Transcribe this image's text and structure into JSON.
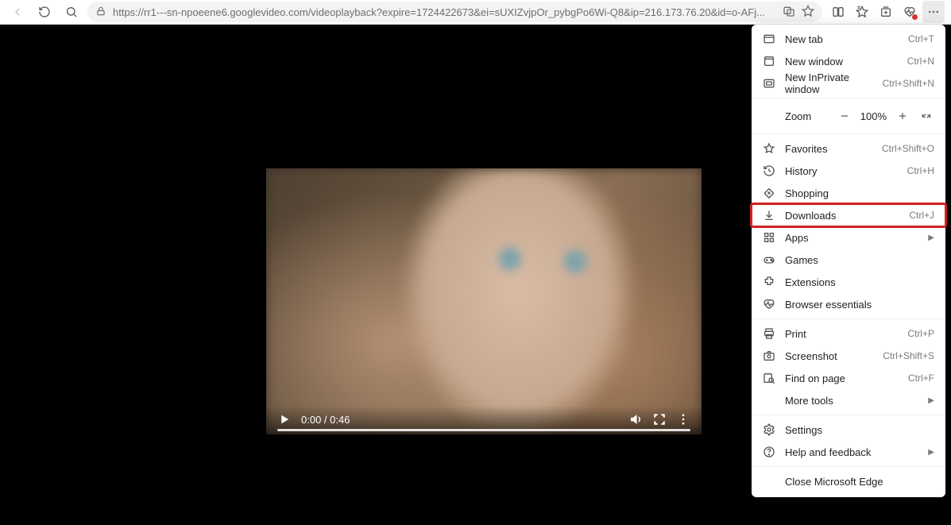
{
  "toolbar": {
    "url": "https://rr1---sn-npoeene6.googlevideo.com/videoplayback?expire=1724422673&ei=sUXIZvjpOr_pybgPo6Wi-Q8&ip=216.173.76.20&id=o-AFj..."
  },
  "video": {
    "time_current": "0:00",
    "time_separator": " / ",
    "time_total": "0:46"
  },
  "menu": {
    "new_tab": {
      "label": "New tab",
      "shortcut": "Ctrl+T"
    },
    "new_window": {
      "label": "New window",
      "shortcut": "Ctrl+N"
    },
    "new_inprivate": {
      "label": "New InPrivate window",
      "shortcut": "Ctrl+Shift+N"
    },
    "zoom": {
      "label": "Zoom",
      "value": "100%"
    },
    "favorites": {
      "label": "Favorites",
      "shortcut": "Ctrl+Shift+O"
    },
    "history": {
      "label": "History",
      "shortcut": "Ctrl+H"
    },
    "shopping": {
      "label": "Shopping"
    },
    "downloads": {
      "label": "Downloads",
      "shortcut": "Ctrl+J"
    },
    "apps": {
      "label": "Apps"
    },
    "games": {
      "label": "Games"
    },
    "extensions": {
      "label": "Extensions"
    },
    "essentials": {
      "label": "Browser essentials"
    },
    "print": {
      "label": "Print",
      "shortcut": "Ctrl+P"
    },
    "screenshot": {
      "label": "Screenshot",
      "shortcut": "Ctrl+Shift+S"
    },
    "find": {
      "label": "Find on page",
      "shortcut": "Ctrl+F"
    },
    "more_tools": {
      "label": "More tools"
    },
    "settings": {
      "label": "Settings"
    },
    "help": {
      "label": "Help and feedback"
    },
    "close": {
      "label": "Close Microsoft Edge"
    }
  }
}
